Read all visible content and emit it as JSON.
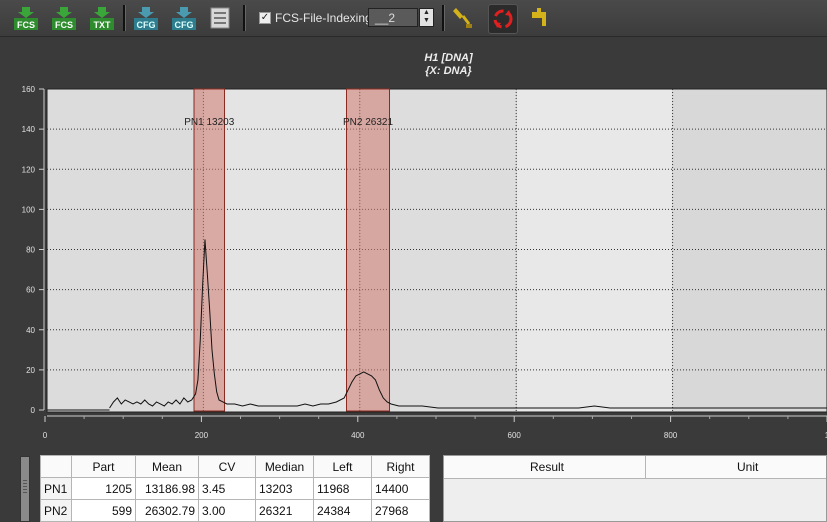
{
  "toolbar": {
    "buttons": [
      {
        "name": "import-fcs-button",
        "label": "FCS",
        "icon": "import-fcs-icon"
      },
      {
        "name": "export-fcs-button",
        "label": "FCS",
        "icon": "export-fcs-icon"
      },
      {
        "name": "export-txt-button",
        "label": "TXT",
        "icon": "export-txt-icon"
      },
      {
        "name": "load-cfg-button",
        "label": "CFG",
        "icon": "load-cfg-icon"
      },
      {
        "name": "save-cfg-button",
        "label": "CFG",
        "icon": "save-cfg-icon"
      },
      {
        "name": "print-button",
        "label": "",
        "icon": "print-icon"
      }
    ],
    "indexing_checked": true,
    "indexing_label": "FCS-File-Indexing",
    "spin_value": "__2",
    "colors": {
      "green": "#2e8b2e",
      "red": "#e02020",
      "yellow": "#d4b21a"
    }
  },
  "chart": {
    "title": "H1 [DNA]",
    "subtitle": "{X: DNA}"
  },
  "chart_data": {
    "type": "histogram",
    "x_ticks": [
      "0",
      "200",
      "400",
      "600",
      "800",
      "1"
    ],
    "y_ticks": [
      "0",
      "20",
      "40",
      "60",
      "80",
      "100",
      "120",
      "140",
      "160"
    ],
    "xlim": [
      0,
      1000
    ],
    "ylim": [
      0,
      160
    ],
    "grid": true,
    "gates": [
      {
        "label": "PN1 13203",
        "x_start": 188,
        "x_end": 227
      },
      {
        "label": "PN2 26321",
        "x_start": 383,
        "x_end": 438
      }
    ],
    "histogram": [
      [
        80,
        1
      ],
      [
        85,
        4
      ],
      [
        90,
        6
      ],
      [
        95,
        3
      ],
      [
        100,
        5
      ],
      [
        105,
        4
      ],
      [
        110,
        3
      ],
      [
        115,
        4
      ],
      [
        120,
        3
      ],
      [
        125,
        5
      ],
      [
        130,
        3
      ],
      [
        135,
        2
      ],
      [
        140,
        4
      ],
      [
        145,
        3
      ],
      [
        150,
        2
      ],
      [
        155,
        4
      ],
      [
        160,
        3
      ],
      [
        165,
        5
      ],
      [
        170,
        3
      ],
      [
        175,
        6
      ],
      [
        180,
        4
      ],
      [
        185,
        5
      ],
      [
        190,
        8
      ],
      [
        193,
        15
      ],
      [
        196,
        35
      ],
      [
        199,
        62
      ],
      [
        202,
        85
      ],
      [
        205,
        68
      ],
      [
        208,
        50
      ],
      [
        211,
        30
      ],
      [
        214,
        18
      ],
      [
        217,
        9
      ],
      [
        220,
        5
      ],
      [
        225,
        4
      ],
      [
        230,
        3
      ],
      [
        240,
        3
      ],
      [
        250,
        2
      ],
      [
        260,
        3
      ],
      [
        270,
        2
      ],
      [
        280,
        2
      ],
      [
        290,
        2
      ],
      [
        300,
        2
      ],
      [
        310,
        2
      ],
      [
        320,
        2
      ],
      [
        330,
        3
      ],
      [
        340,
        2
      ],
      [
        350,
        3
      ],
      [
        360,
        3
      ],
      [
        370,
        4
      ],
      [
        380,
        6
      ],
      [
        385,
        10
      ],
      [
        390,
        14
      ],
      [
        395,
        17
      ],
      [
        400,
        18
      ],
      [
        405,
        19
      ],
      [
        410,
        18
      ],
      [
        415,
        17
      ],
      [
        420,
        15
      ],
      [
        425,
        10
      ],
      [
        430,
        6
      ],
      [
        435,
        4
      ],
      [
        440,
        3
      ],
      [
        450,
        2
      ],
      [
        460,
        2
      ],
      [
        480,
        2
      ],
      [
        500,
        1
      ],
      [
        520,
        1
      ],
      [
        540,
        1
      ],
      [
        560,
        1
      ],
      [
        580,
        1
      ],
      [
        600,
        1
      ],
      [
        620,
        1
      ],
      [
        640,
        1
      ],
      [
        660,
        1
      ],
      [
        680,
        1
      ],
      [
        700,
        2
      ],
      [
        720,
        1
      ],
      [
        740,
        1
      ],
      [
        760,
        1
      ],
      [
        780,
        1
      ],
      [
        800,
        1
      ],
      [
        820,
        1
      ],
      [
        840,
        1
      ],
      [
        860,
        1
      ],
      [
        880,
        1
      ],
      [
        900,
        1
      ],
      [
        920,
        1
      ],
      [
        940,
        1
      ],
      [
        960,
        1
      ],
      [
        980,
        1
      ],
      [
        1000,
        1
      ]
    ]
  },
  "stats": {
    "headers": [
      "",
      "Part",
      "Mean",
      "CV",
      "Median",
      "Left",
      "Right"
    ],
    "rows": [
      [
        "PN1",
        "1205",
        "13186.98",
        "3.45",
        "13203",
        "11968",
        "14400"
      ],
      [
        "PN2",
        "599",
        "26302.79",
        "3.00",
        "26321",
        "24384",
        "27968"
      ]
    ]
  },
  "results": {
    "headers": [
      "Result",
      "Unit"
    ]
  }
}
